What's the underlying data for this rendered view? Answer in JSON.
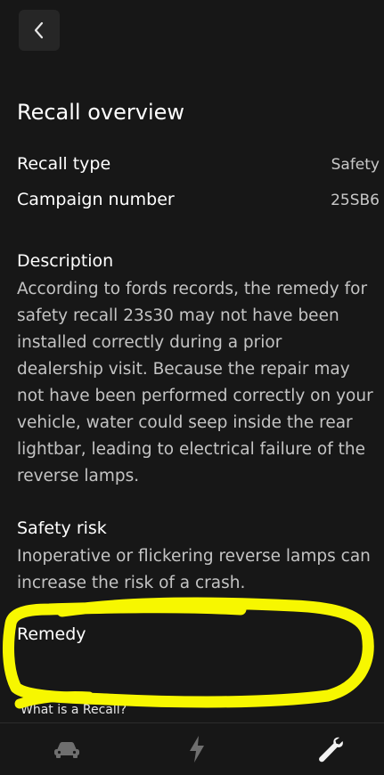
{
  "header": {
    "back_icon": "chevron-left-icon"
  },
  "page": {
    "title": "Recall overview"
  },
  "details": {
    "recall_type_label": "Recall type",
    "recall_type_value": "Safety",
    "campaign_label": "Campaign number",
    "campaign_value": "25SB6"
  },
  "description": {
    "heading": "Description",
    "body": "According to fords records, the remedy for safety recall 23s30 may not have been installed correctly during a prior dealership visit. Because the repair may not have been performed correctly on your vehicle, water could seep inside the rear lightbar, leading to electrical failure of the reverse lamps."
  },
  "safety_risk": {
    "heading": "Safety risk",
    "body": "Inoperative or flickering reverse lamps can increase the risk of a crash."
  },
  "remedy": {
    "heading": "Remedy"
  },
  "link": {
    "label": "What is a Recall?"
  },
  "bottom_nav": {
    "tabs": [
      {
        "icon": "car-icon",
        "active": false
      },
      {
        "icon": "charge-bolt-icon",
        "active": false
      },
      {
        "icon": "wrench-icon",
        "active": true
      }
    ]
  },
  "annotation": {
    "highlight_color": "#f7f700"
  }
}
